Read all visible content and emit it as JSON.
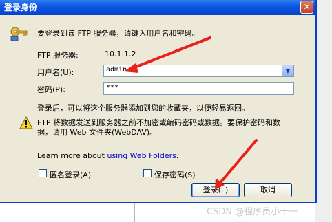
{
  "dialog": {
    "title": "登录身份",
    "close_glyph": "✕",
    "prompt": "要登录到该 FTP 服务器，请键入用户名和密码。",
    "server_label": "FTP 服务器:",
    "server_value": "10.1.1.2",
    "username_label": "用户名(U):",
    "username_value": "admin",
    "password_label": "密码(P):",
    "password_value": "***",
    "favorites_note": "登录后，可以将这个服务器添加到您的收藏夹，以便轻易返回。",
    "warning_line1": "FTP 将数据发送到服务器之前不加密或编码密码或数据。要保护密码和数",
    "warning_line2": "据，请用 Web 文件夹(WebDAV)。",
    "learn_more_prefix": "Learn more about ",
    "learn_more_link": "using Web Folders",
    "learn_more_suffix": ".",
    "anonymous_label": "匿名登录(A)",
    "save_password_label": "保存密码(S)",
    "login_button": "登录(L)",
    "cancel_button": "取消"
  },
  "watermark": "CSDN @程序员小十一",
  "icons": {
    "key": "key-icon",
    "warning": "warning-icon",
    "dropdown": "chevron-down-icon",
    "close": "close-icon"
  },
  "colors": {
    "titlebar": "#0b55e2",
    "dialog_bg": "#ece9d8",
    "arrow": "#e8211b",
    "link": "#0000cc"
  }
}
